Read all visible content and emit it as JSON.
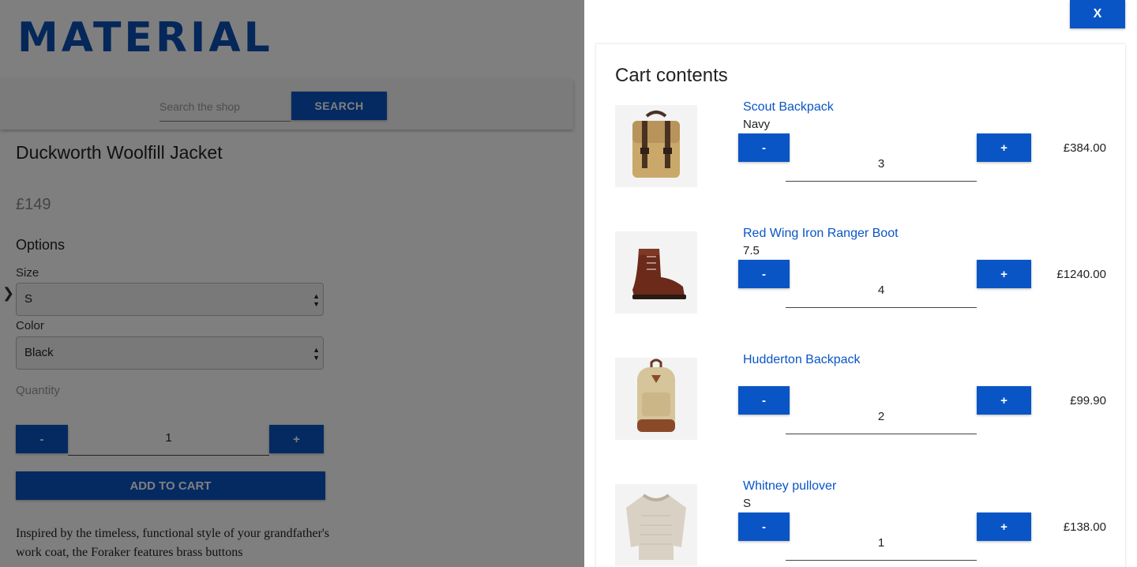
{
  "page": {
    "logo": "MATERIAL",
    "search": {
      "placeholder": "Search the shop",
      "button_label": "SEARCH"
    },
    "product": {
      "title": "Duckworth Woolfill Jacket",
      "price": "£149",
      "options_title": "Options",
      "size_label": "Size",
      "size_value": "S",
      "color_label": "Color",
      "color_value": "Black",
      "quantity_label": "Quantity",
      "quantity_value": "1",
      "minus_label": "-",
      "plus_label": "+",
      "add_to_cart_label": "ADD TO CART",
      "description": "Inspired by the timeless, functional style of your grandfather's work coat, the Foraker features brass buttons"
    }
  },
  "cart": {
    "close_label": "X",
    "title": "Cart contents",
    "minus_label": "-",
    "plus_label": "+",
    "items": [
      {
        "name": "Scout Backpack",
        "variant": "Navy",
        "quantity": "3",
        "price": "£384.00",
        "icon": "backpack-icon"
      },
      {
        "name": "Red Wing Iron Ranger Boot",
        "variant": "7.5",
        "quantity": "4",
        "price": "£1240.00",
        "icon": "boot-icon"
      },
      {
        "name": "Hudderton Backpack",
        "variant": "",
        "quantity": "2",
        "price": "£99.90",
        "icon": "backpack-icon"
      },
      {
        "name": "Whitney pullover",
        "variant": "S",
        "quantity": "1",
        "price": "£138.00",
        "icon": "sweater-icon"
      }
    ]
  },
  "colors": {
    "accent": "#0a55c5",
    "logo": "#0a4fb5",
    "link": "#0a55c5"
  }
}
